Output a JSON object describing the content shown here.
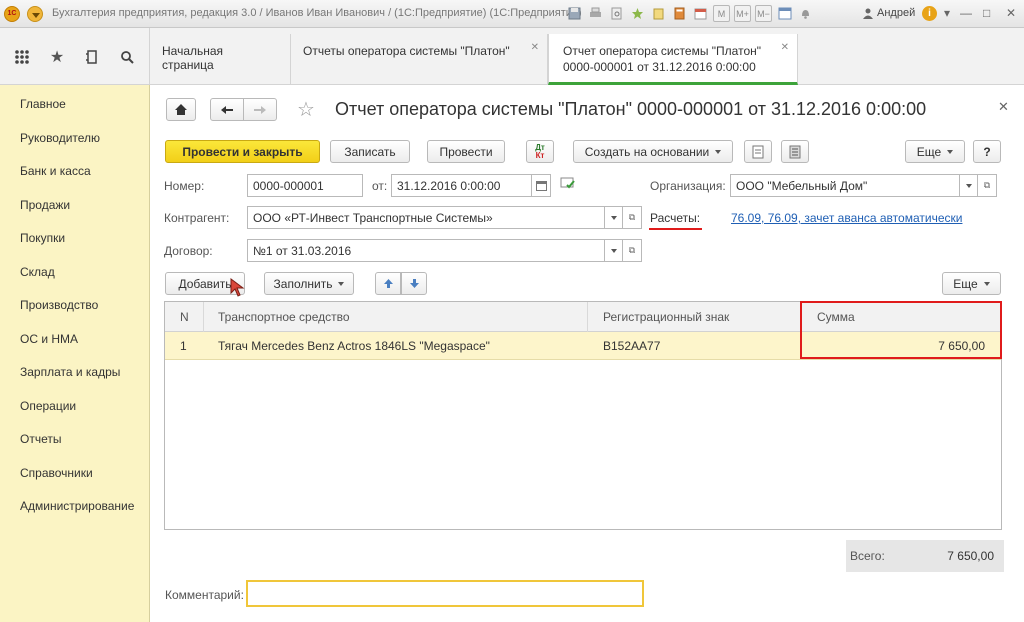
{
  "window": {
    "title": "Бухгалтерия предприятия, редакция 3.0 / Иванов Иван Иванович / (1С:Предприятие)   (1С:Предприятие)",
    "logo_text": "1С",
    "toolbar_labels": [
      "M",
      "M+",
      "M−"
    ],
    "user": "Андрей",
    "info_label": "i"
  },
  "tabs": [
    {
      "label": "Начальная страница"
    },
    {
      "label": "Отчеты оператора системы \"Платон\""
    },
    {
      "label": "Отчет оператора системы \"Платон\"",
      "label2": "0000-000001 от 31.12.2016 0:00:00"
    }
  ],
  "sidebar": {
    "items": [
      "Главное",
      "Руководителю",
      "Банк и касса",
      "Продажи",
      "Покупки",
      "Склад",
      "Производство",
      "ОС и НМА",
      "Зарплата и кадры",
      "Операции",
      "Отчеты",
      "Справочники",
      "Администрирование"
    ]
  },
  "form": {
    "title": "Отчет оператора системы \"Платон\" 0000-000001 от 31.12.2016 0:00:00",
    "buttons": {
      "post_close": "Провести и закрыть",
      "save": "Записать",
      "post": "Провести",
      "dtkt_top": "Дт",
      "dtkt_bottom": "Кт",
      "create_based": "Создать на основании",
      "more": "Еще",
      "help": "?"
    },
    "number_label": "Номер:",
    "number_value": "0000-000001",
    "date_label": "от:",
    "date_value": "31.12.2016  0:00:00",
    "org_label": "Организация:",
    "org_value": "ООО \"Мебельный Дом\"",
    "counterparty_label": "Контрагент:",
    "counterparty_value": "ООО «РТ-Инвест Транспортные Системы»",
    "payments_label": "Расчеты:",
    "payments_link": "76.09, 76.09, зачет аванса автоматически",
    "contract_label": "Договор:",
    "contract_value": "№1 от 31.03.2016",
    "table_toolbar": {
      "add": "Добавить",
      "fill": "Заполнить",
      "more": "Еще"
    },
    "table": {
      "columns": [
        "N",
        "Транспортное средство",
        "Регистрационный знак",
        "Сумма"
      ],
      "rows": [
        {
          "n": "1",
          "vehicle": "Тягач Mercedes Benz Actros 1846LS \"Megaspace\"",
          "reg": "B152AA77",
          "sum": "7 650,00"
        }
      ]
    },
    "total_label": "Всего:",
    "total_value": "7 650,00",
    "comment_label": "Комментарий:",
    "comment_value": ""
  },
  "colors": {
    "sidebar_bg": "#fbf4c4",
    "primary_button": "#f2cf18",
    "active_tab_underline": "#3da33a",
    "highlight_red": "#e01b1b",
    "link": "#1f5fb4"
  }
}
